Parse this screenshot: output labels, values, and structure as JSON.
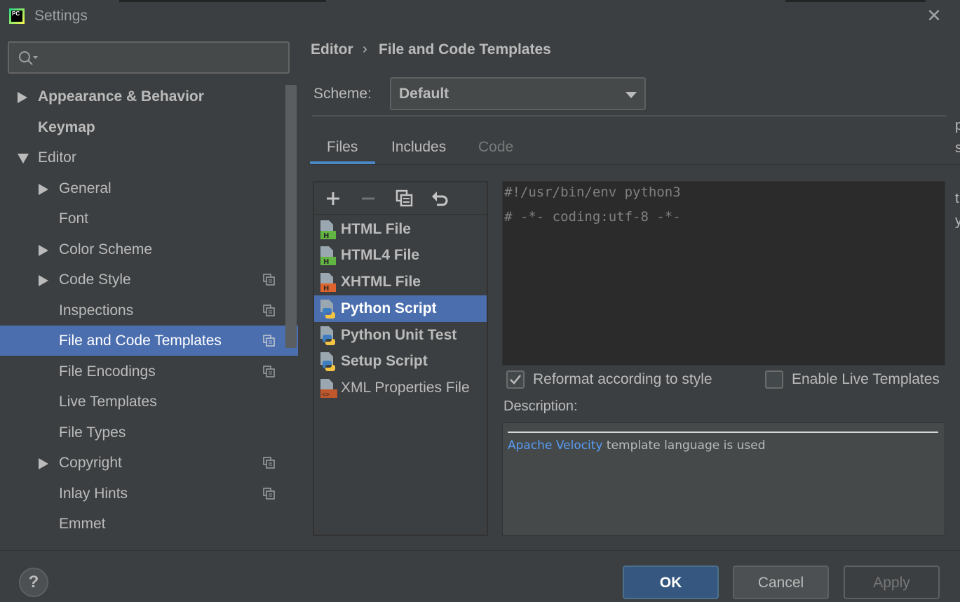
{
  "window": {
    "title": "Settings",
    "app_icon": "pycharm-logo",
    "app_icon_text": "PC"
  },
  "search": {
    "placeholder": "",
    "value": ""
  },
  "sidebar": {
    "items": [
      {
        "label": "Appearance & Behavior",
        "bold": true,
        "expander": "collapsed",
        "level": 0,
        "selected": false
      },
      {
        "label": "Keymap",
        "bold": true,
        "expander": "none",
        "level": 0,
        "selected": false
      },
      {
        "label": "Editor",
        "bold": false,
        "expander": "expanded",
        "level": 0,
        "selected": false
      },
      {
        "label": "General",
        "expander": "collapsed",
        "level": 1,
        "selected": false
      },
      {
        "label": "Font",
        "expander": "none",
        "level": 1,
        "selected": false
      },
      {
        "label": "Color Scheme",
        "expander": "collapsed",
        "level": 1,
        "selected": false
      },
      {
        "label": "Code Style",
        "expander": "collapsed",
        "level": 1,
        "selected": false,
        "project_icon": true
      },
      {
        "label": "Inspections",
        "expander": "none",
        "level": 1,
        "selected": false,
        "project_icon": true
      },
      {
        "label": "File and Code Templates",
        "expander": "none",
        "level": 1,
        "selected": true,
        "project_icon": true
      },
      {
        "label": "File Encodings",
        "expander": "none",
        "level": 1,
        "selected": false,
        "project_icon": true
      },
      {
        "label": "Live Templates",
        "expander": "none",
        "level": 1,
        "selected": false
      },
      {
        "label": "File Types",
        "expander": "none",
        "level": 1,
        "selected": false
      },
      {
        "label": "Copyright",
        "expander": "collapsed",
        "level": 1,
        "selected": false,
        "project_icon": true
      },
      {
        "label": "Inlay Hints",
        "expander": "none",
        "level": 1,
        "selected": false,
        "project_icon": true
      },
      {
        "label": "Emmet",
        "expander": "none",
        "level": 1,
        "selected": false
      }
    ]
  },
  "breadcrumb": {
    "parent": "Editor",
    "separator": "›",
    "current": "File and Code Templates"
  },
  "scheme": {
    "label": "Scheme:",
    "value": "Default"
  },
  "tabs": [
    {
      "label": "Files",
      "active": true,
      "enabled": true
    },
    {
      "label": "Includes",
      "active": false,
      "enabled": true
    },
    {
      "label": "Code",
      "active": false,
      "enabled": false
    }
  ],
  "toolbar": {
    "add_icon": "plus-icon",
    "remove_icon": "minus-icon",
    "copy_icon": "copy-icon",
    "reset_icon": "undo-icon"
  },
  "templates": [
    {
      "label": "HTML File",
      "icon": "html-file-icon",
      "bold": true,
      "selected": false
    },
    {
      "label": "HTML4 File",
      "icon": "html-file-icon",
      "bold": true,
      "selected": false
    },
    {
      "label": "XHTML File",
      "icon": "xhtml-file-icon",
      "bold": true,
      "selected": false
    },
    {
      "label": "Python Script",
      "icon": "python-file-icon",
      "bold": true,
      "selected": true
    },
    {
      "label": "Python Unit Test",
      "icon": "python-file-icon",
      "bold": true,
      "selected": false
    },
    {
      "label": "Setup Script",
      "icon": "python-file-icon",
      "bold": true,
      "selected": false
    },
    {
      "label": "XML Properties File",
      "icon": "xml-file-icon",
      "bold": false,
      "selected": false
    }
  ],
  "editor": {
    "lines": [
      "#!/usr/bin/env python3",
      "# -*- coding:utf-8 -*-"
    ]
  },
  "options": {
    "reformat": {
      "label": "Reformat according to style",
      "checked": true
    },
    "live_templates": {
      "label": "Enable Live Templates",
      "checked": false
    }
  },
  "description": {
    "label": "Description:",
    "link_text": "Apache Velocity",
    "text": " template language is used"
  },
  "footer": {
    "help": "?",
    "ok": "OK",
    "cancel": "Cancel",
    "apply": "Apply"
  },
  "colors": {
    "background": "#3c3f41",
    "selection": "#4b6eaf",
    "editor_bg": "#2b2b2b",
    "link": "#589df6",
    "ok_button": "#365880"
  }
}
